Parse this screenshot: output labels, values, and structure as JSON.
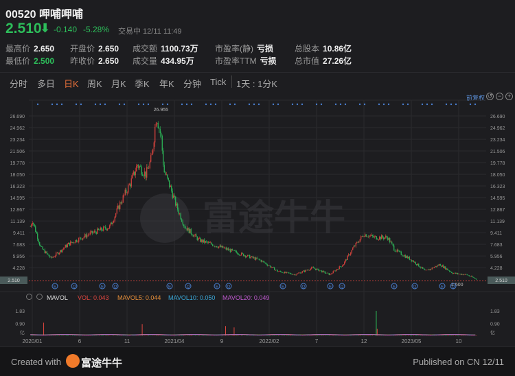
{
  "header": {
    "title": "00520 呷哺呷哺",
    "price": "2.510",
    "arrow": "⬇",
    "change": "-0.140",
    "change_pct": "-5.28%",
    "status": "交易中 12/11 11:49"
  },
  "stats": [
    {
      "label": "最高价",
      "value": "2.650",
      "green": false
    },
    {
      "label": "最低价",
      "value": "2.500",
      "green": true
    },
    {
      "label": "开盘价",
      "value": "2.650",
      "green": false
    },
    {
      "label": "昨收价",
      "value": "2.650",
      "green": false
    },
    {
      "label": "成交额",
      "value": "1100.73万",
      "green": false
    },
    {
      "label": "成交量",
      "value": "434.95万",
      "green": false
    },
    {
      "label": "市盈率(静)",
      "value": "亏损",
      "green": false
    },
    {
      "label": "市盈率TTM",
      "value": "亏损",
      "green": false
    },
    {
      "label": "总股本",
      "value": "10.86亿",
      "green": false
    },
    {
      "label": "总市值",
      "value": "27.26亿",
      "green": false
    }
  ],
  "tabs": [
    "分时",
    "多日",
    "日K",
    "周K",
    "月K",
    "季K",
    "年K",
    "分钟",
    "Tick",
    "1天 : 1分K"
  ],
  "active_tab": "日K",
  "toolbar": {
    "adjust": "前复权",
    "icons": [
      "undo-icon",
      "zoom-out-icon",
      "zoom-in-icon"
    ]
  },
  "indicators": {
    "name": "MAVOL",
    "vol": "VOL: 0.043",
    "ma5": "MAVOL5: 0.044",
    "ma10": "MAVOL10: 0.050",
    "ma20": "MAVOL20: 0.049"
  },
  "footer": {
    "created": "Created with",
    "brand": "富途牛牛",
    "published": "Published on CN 12/11"
  },
  "watermark": "富途牛牛",
  "colors": {
    "up": "#e0463f",
    "down": "#2dbd5a",
    "bg": "#1d1d20",
    "ma5": "#e8903a",
    "ma10": "#3aa8d8",
    "ma20": "#c05ad0"
  },
  "chart_data": {
    "type": "candlestick",
    "y_ticks": [
      "26.690",
      "24.962",
      "23.234",
      "21.506",
      "19.778",
      "18.050",
      "16.323",
      "14.595",
      "12.867",
      "11.139",
      "9.411",
      "7.683",
      "5.956",
      "4.228",
      "2.510"
    ],
    "ylim": [
      2.51,
      26.69
    ],
    "x_ticks": [
      "2020/01",
      "6",
      "11",
      "2021/04",
      "9",
      "2022/02",
      "7",
      "12",
      "2023/05",
      "10"
    ],
    "x_tick_months": [
      0,
      5,
      10,
      15,
      20,
      25,
      30,
      35,
      40,
      45
    ],
    "max_label": "26.955",
    "min_label": "2.500",
    "last_price": "2.510",
    "close_path_months": [
      -0.2,
      0,
      0.9,
      2,
      3.8,
      6,
      8.2,
      9.3,
      10.4,
      11.1,
      12,
      12.6,
      13.1,
      13.6,
      13.9,
      14.6,
      15.2,
      16.1,
      17.6,
      19.8,
      21.9,
      24.1,
      25.9,
      27.7,
      29.6,
      31.4,
      32.8,
      33.9,
      35,
      36.1,
      37.5,
      38.3,
      40.1,
      41.5,
      43,
      44.4,
      45.8,
      46.9
    ],
    "close_path_prices": [
      10.3,
      11.3,
      7.2,
      5.6,
      7.7,
      9.2,
      10.3,
      13.8,
      16.9,
      19.5,
      18,
      20.5,
      26.9,
      23.5,
      18.5,
      16,
      13.4,
      10.3,
      8.3,
      7.3,
      6.3,
      5.3,
      3.7,
      3.2,
      4.2,
      3.2,
      4.7,
      7.2,
      9.2,
      8.7,
      8.7,
      6.8,
      5.3,
      3.7,
      4.7,
      3.4,
      3.2,
      2.5
    ],
    "volume_ticks": [
      "1.83",
      "0.90",
      "亿"
    ],
    "volume_spikes": [
      {
        "month": 1.2,
        "value": 0.95
      },
      {
        "month": 11.6,
        "value": 0.85
      },
      {
        "month": 20.4,
        "value": 0.7
      },
      {
        "month": 21.3,
        "value": 0.6
      },
      {
        "month": 36.3,
        "value": 1.83
      },
      {
        "month": 36.4,
        "value": 0.5
      }
    ],
    "events": [
      "E",
      "Q",
      "E",
      "Q",
      "E",
      "Q",
      "E",
      "Q",
      "E",
      "Q",
      "E",
      "Q",
      "E",
      "Q",
      "E",
      "Q"
    ]
  }
}
